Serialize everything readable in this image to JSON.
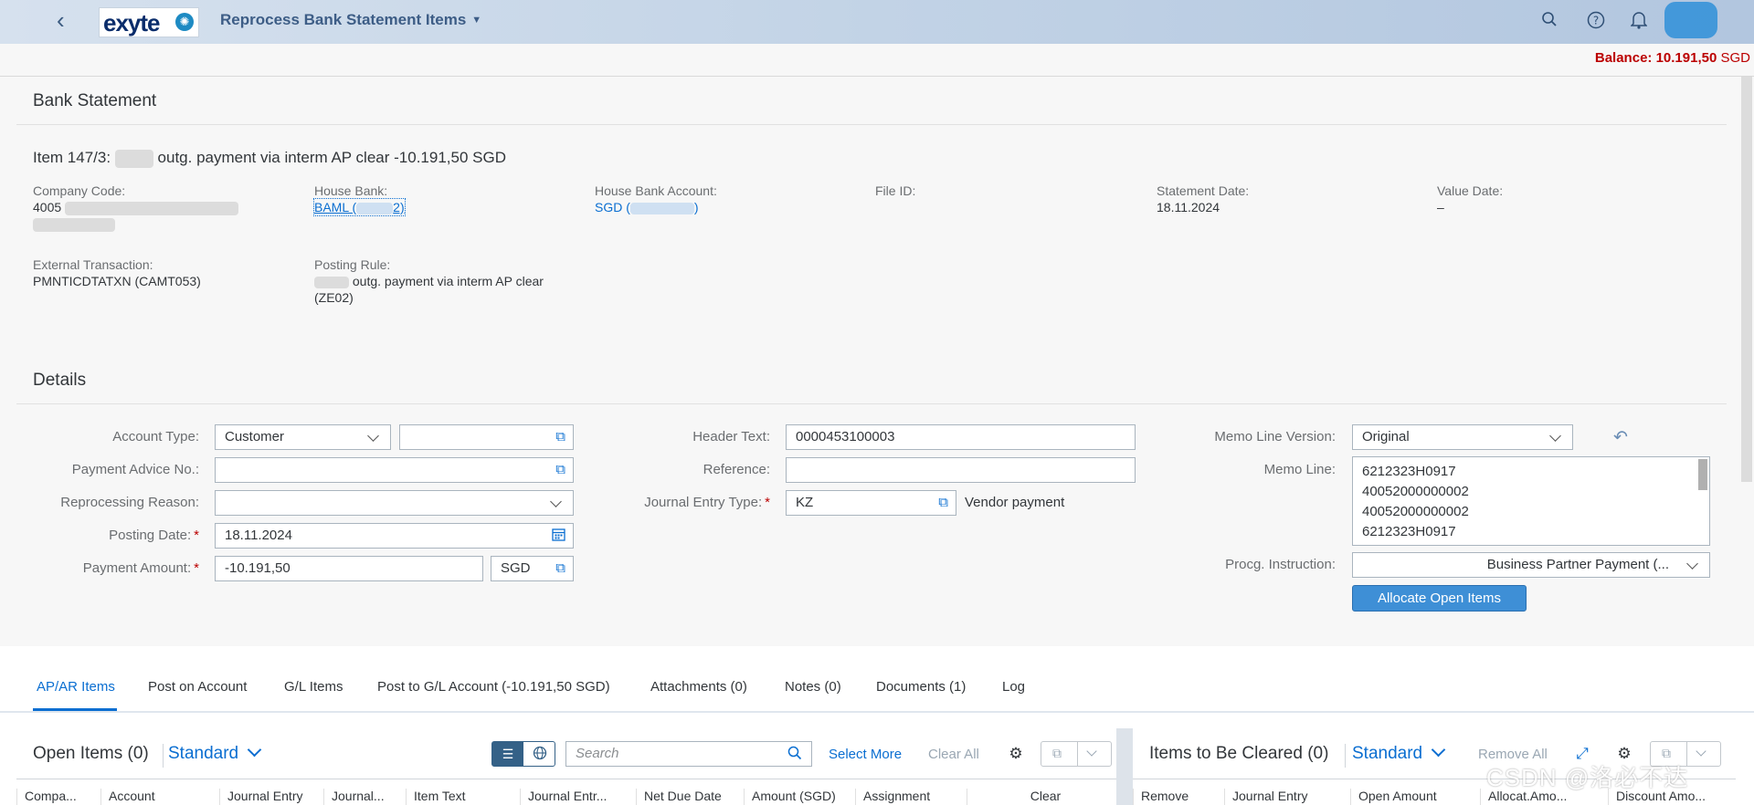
{
  "shell": {
    "title": "Reprocess Bank Statement Items",
    "logo_text": "exyte"
  },
  "balance": {
    "label": "Balance:",
    "value": "10.191,50",
    "currency": "SGD"
  },
  "bank_statement": {
    "section_title": "Bank Statement",
    "item_prefix": "Item 147/3:",
    "item_suffix": "outg. payment via interm AP clear -10.191,50 SGD",
    "fields": {
      "company_code_label": "Company Code:",
      "company_code_value": "4005",
      "house_bank_label": "House Bank:",
      "house_bank_value": "BAML (",
      "house_bank_value_end": "2)",
      "house_bank_account_label": "House Bank Account:",
      "house_bank_account_value": "SGD (",
      "house_bank_account_value_end": ")",
      "file_id_label": "File ID:",
      "statement_date_label": "Statement Date:",
      "statement_date_value": "18.11.2024",
      "value_date_label": "Value Date:",
      "value_date_value": "–",
      "external_transaction_label": "External Transaction:",
      "external_transaction_value": "PMNTICDTATXN (CAMT053)",
      "posting_rule_label": "Posting Rule:",
      "posting_rule_value": "outg. payment via interm AP clear",
      "posting_rule_code": "(ZE02)"
    }
  },
  "details": {
    "section_title": "Details",
    "account_type_label": "Account Type:",
    "account_type_value": "Customer",
    "payment_advice_label": "Payment Advice No.:",
    "reprocessing_reason_label": "Reprocessing Reason:",
    "posting_date_label": "Posting Date:",
    "posting_date_value": "18.11.2024",
    "payment_amount_label": "Payment Amount:",
    "payment_amount_value": "-10.191,50",
    "payment_currency": "SGD",
    "header_text_label": "Header Text:",
    "header_text_value": "0000453100003",
    "reference_label": "Reference:",
    "journal_entry_type_label": "Journal Entry Type:",
    "journal_entry_type_value": "KZ",
    "journal_entry_type_desc": "Vendor payment",
    "memo_line_version_label": "Memo Line Version:",
    "memo_line_version_value": "Original",
    "memo_line_label": "Memo Line:",
    "memo_lines": [
      "6212323H0917",
      "40052000000002",
      "40052000000002",
      "6212323H0917"
    ],
    "procg_instruction_label": "Procg. Instruction:",
    "procg_instruction_value": "Business Partner Payment (...",
    "allocate_button": "Allocate Open Items"
  },
  "tabs": [
    {
      "label": "AP/AR Items"
    },
    {
      "label": "Post on Account"
    },
    {
      "label": "G/L Items"
    },
    {
      "label": "Post to G/L Account (-10.191,50 SGD)"
    },
    {
      "label": "Attachments (0)"
    },
    {
      "label": "Notes (0)"
    },
    {
      "label": "Documents (1)"
    },
    {
      "label": "Log"
    }
  ],
  "open_items": {
    "title": "Open Items (0)",
    "variant": "Standard",
    "search_placeholder": "Search",
    "select_more": "Select More",
    "clear_all": "Clear All",
    "columns": [
      "Compa...",
      "Account",
      "Journal Entry",
      "Journal...",
      "Item Text",
      "Journal Entr...",
      "Net Due Date",
      "Amount (SGD)",
      "Assignment",
      "Clear"
    ]
  },
  "items_to_be_cleared": {
    "title": "Items to Be Cleared (0)",
    "variant": "Standard",
    "remove_all": "Remove All",
    "columns": [
      "Remove",
      "Journal Entry",
      "Open Amount",
      "Allocat.Amo...",
      "Discount Amo..."
    ]
  },
  "watermark": "CSDN @洛必不达",
  "icons": [
    "back-icon",
    "search-icon",
    "help-icon",
    "bell-icon",
    "value-help-icon",
    "calendar-icon",
    "undo-icon",
    "list-icon",
    "globe-icon",
    "settings-icon",
    "fullscreen-icon",
    "chevron-down-icon"
  ]
}
